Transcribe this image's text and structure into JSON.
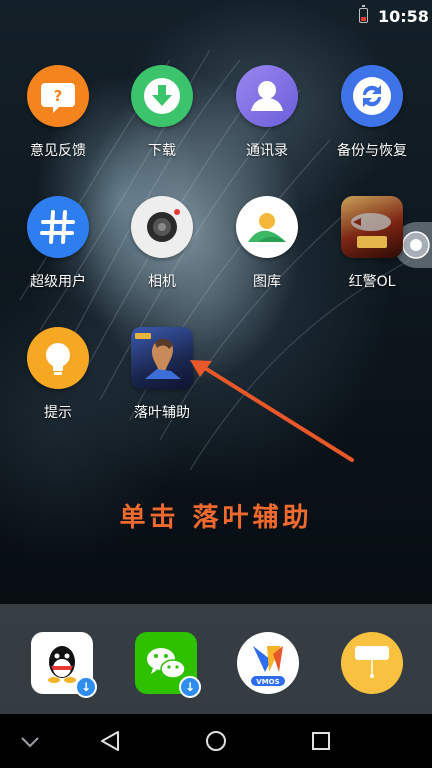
{
  "status_bar": {
    "time": "10:58",
    "battery_icon": "battery-low-icon"
  },
  "home": {
    "apps": [
      {
        "label": "意见反馈",
        "icon": "feedback-icon",
        "color": "#f5841f"
      },
      {
        "label": "下载",
        "icon": "download-icon",
        "color": "#3bc46b"
      },
      {
        "label": "通讯录",
        "icon": "contacts-icon",
        "color": "#8a74e8"
      },
      {
        "label": "备份与恢复",
        "icon": "backup-icon",
        "color": "#3f74e8"
      },
      {
        "label": "超级用户",
        "icon": "hash-icon",
        "color": "#2f7ef0"
      },
      {
        "label": "相机",
        "icon": "camera-icon",
        "color": "#eeeeee"
      },
      {
        "label": "图库",
        "icon": "gallery-icon",
        "color": "#ffffff"
      },
      {
        "label": "红警OL",
        "icon": "red-alert-game-icon",
        "color": "#8a2a1a"
      },
      {
        "label": "提示",
        "icon": "lightbulb-icon",
        "color": "#f7a823"
      },
      {
        "label": "落叶辅助",
        "icon": "luoye-helper-app-icon",
        "color": "#2b3d74"
      }
    ]
  },
  "annotation": {
    "text": "单击 落叶辅助",
    "color": "#f06a30"
  },
  "dock": {
    "apps": [
      {
        "icon": "qq-icon",
        "badge": "download-badge-icon"
      },
      {
        "icon": "wechat-icon",
        "badge": "download-badge-icon"
      },
      {
        "icon": "vmos-icon",
        "brand": "VMOS"
      },
      {
        "icon": "notes-icon"
      }
    ]
  },
  "nav": {
    "back": "back-icon",
    "home": "home-icon",
    "recents": "recents-icon",
    "expand": "chevron-down-icon"
  }
}
